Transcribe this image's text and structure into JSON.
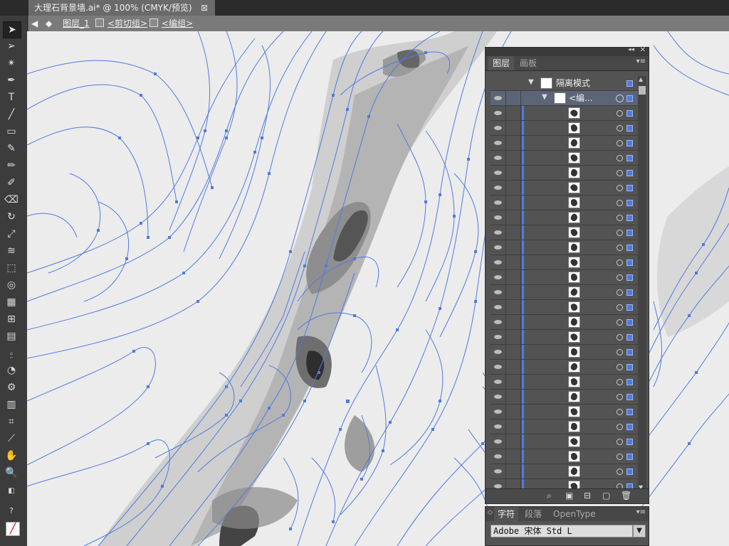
{
  "document": {
    "title": "大理石背景墙.ai* @ 100% (CMYK/预览)",
    "close": "⊠"
  },
  "breadcrumb": {
    "layer": "图层_1",
    "clip_group": "<剪切组>",
    "group": "<编组>"
  },
  "colors": {
    "path": "#4f7be0",
    "canvas": "#ececec",
    "panel": "#535353",
    "accent": "#4f7be0"
  },
  "toolbar": {
    "tools": [
      "selection-tool",
      "direct-selection-tool",
      "magic-wand-tool",
      "pen-tool",
      "type-tool",
      "line-tool",
      "rectangle-tool",
      "paintbrush-tool",
      "pencil-tool",
      "blob-brush-tool",
      "eraser-tool",
      "rotate-tool",
      "scale-tool",
      "warp-tool",
      "free-transform-tool",
      "shape-builder-tool",
      "perspective-grid-tool",
      "mesh-tool",
      "gradient-tool",
      "eyedropper-tool",
      "blend-tool",
      "symbol-sprayer-tool",
      "column-graph-tool",
      "artboard-tool",
      "slice-tool",
      "hand-tool",
      "zoom-tool"
    ]
  },
  "layers_panel": {
    "tabs": [
      "图层",
      "画板"
    ],
    "parent_row": "隔离模式",
    "group_row": "<编...",
    "row_count": 26
  },
  "char_panel": {
    "tabs": [
      "字符",
      "段落",
      "OpenType"
    ],
    "font": "Adobe 宋体 Std L"
  }
}
